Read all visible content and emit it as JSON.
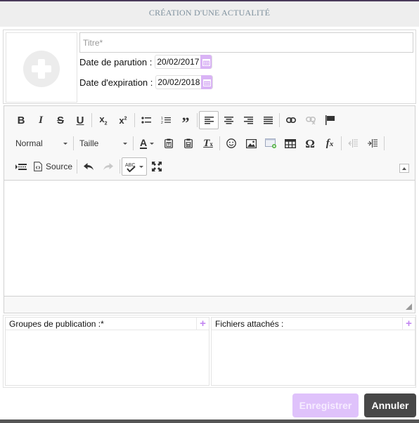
{
  "modal": {
    "title": "CRÉATION D'UNE ACTUALITÉ"
  },
  "form": {
    "thumbnail": {
      "icon": "add-circle-icon"
    },
    "title_placeholder": "Titre*",
    "title_value": "",
    "publication_date": {
      "label": "Date de parution :",
      "value": "20/02/2017",
      "icon": "calendar-icon"
    },
    "expiration_date": {
      "label": "Date d'expiration :",
      "value": "20/02/2018",
      "icon": "calendar-icon"
    }
  },
  "editor": {
    "toolbar": {
      "row1": [
        "bold",
        "italic",
        "strikethrough",
        "underline",
        "subscript",
        "superscript",
        "bulleted-list",
        "numbered-list",
        "blockquote",
        "align-left",
        "align-center",
        "align-right",
        "justify",
        "link",
        "unlink",
        "anchor"
      ],
      "row2": {
        "format_select": "Normal",
        "size_select": "Taille",
        "tools": [
          "text-color",
          "paste-as-text",
          "paste-from-word",
          "remove-format",
          "smiley",
          "image",
          "iframe",
          "table",
          "special-char",
          "formula",
          "decrease-indent",
          "increase-indent"
        ]
      },
      "row3": {
        "source_label": "Source",
        "tools": [
          "show-blocks",
          "source",
          "undo",
          "redo",
          "spellcheck",
          "maximize"
        ]
      },
      "active_alignment": "left"
    },
    "content": ""
  },
  "panels": {
    "groups": {
      "title": "Groupes de publication :*",
      "add_icon": "+"
    },
    "attachments": {
      "title": "Fichiers attachés :",
      "add_icon": "+"
    }
  },
  "actions": {
    "save_label": "Enregistrer",
    "cancel_label": "Annuler"
  },
  "colors": {
    "accent": "#d9b3f5",
    "accent_text": "#c387f2",
    "save_bg": "#dfc2fb",
    "cancel_bg": "#474747",
    "header_bg": "#eeeeee",
    "title_color": "#7f919e"
  }
}
